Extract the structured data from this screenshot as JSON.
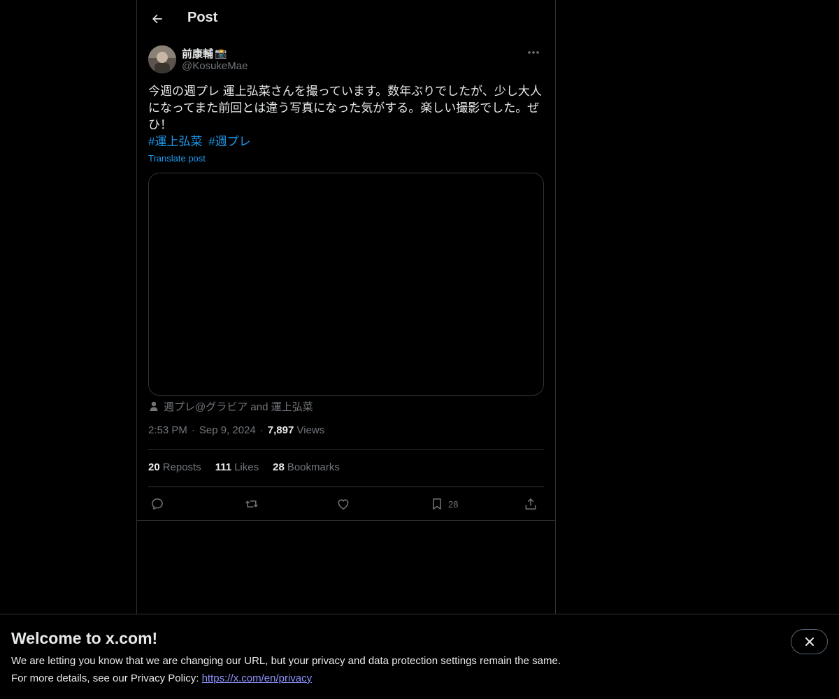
{
  "header": {
    "title": "Post"
  },
  "post": {
    "author": {
      "display_name": "前康輔",
      "emoji": "📸",
      "handle": "@KosukeMae"
    },
    "text": "今週の週プレ 運上弘菜さんを撮っています。数年ぶりでしたが、少し大人になってまた前回とは違う写真になった気がする。楽しい撮影でした。ぜひ！",
    "hashtags": [
      "#運上弘菜",
      "#週プレ"
    ],
    "translate_label": "Translate post",
    "tagged": "週プレ@グラビア and 運上弘菜",
    "time": "2:53 PM",
    "date": "Sep 9, 2024",
    "separator": "·",
    "views_count": "7,897",
    "views_label": "Views",
    "stats": {
      "reposts_count": "20",
      "reposts_label": "Reposts",
      "likes_count": "111",
      "likes_label": "Likes",
      "bookmarks_count": "28",
      "bookmarks_label": "Bookmarks"
    },
    "actions": {
      "bookmark_count": "28"
    }
  },
  "banner": {
    "title": "Welcome to x.com!",
    "line1": "We are letting you know that we are changing our URL, but your privacy and data protection settings remain the same.",
    "line2_prefix": "For more details, see our Privacy Policy: ",
    "link": "https://x.com/en/privacy"
  },
  "colors": {
    "background": "#000000",
    "text": "#e7e9ea",
    "muted": "#71767b",
    "accent": "#1d9bf0",
    "border": "#2f3336",
    "link": "#8f93ff"
  },
  "icons": [
    "arrow-left-icon",
    "more-icon",
    "person-icon",
    "reply-icon",
    "repost-icon",
    "like-icon",
    "bookmark-icon",
    "share-icon",
    "close-icon"
  ]
}
